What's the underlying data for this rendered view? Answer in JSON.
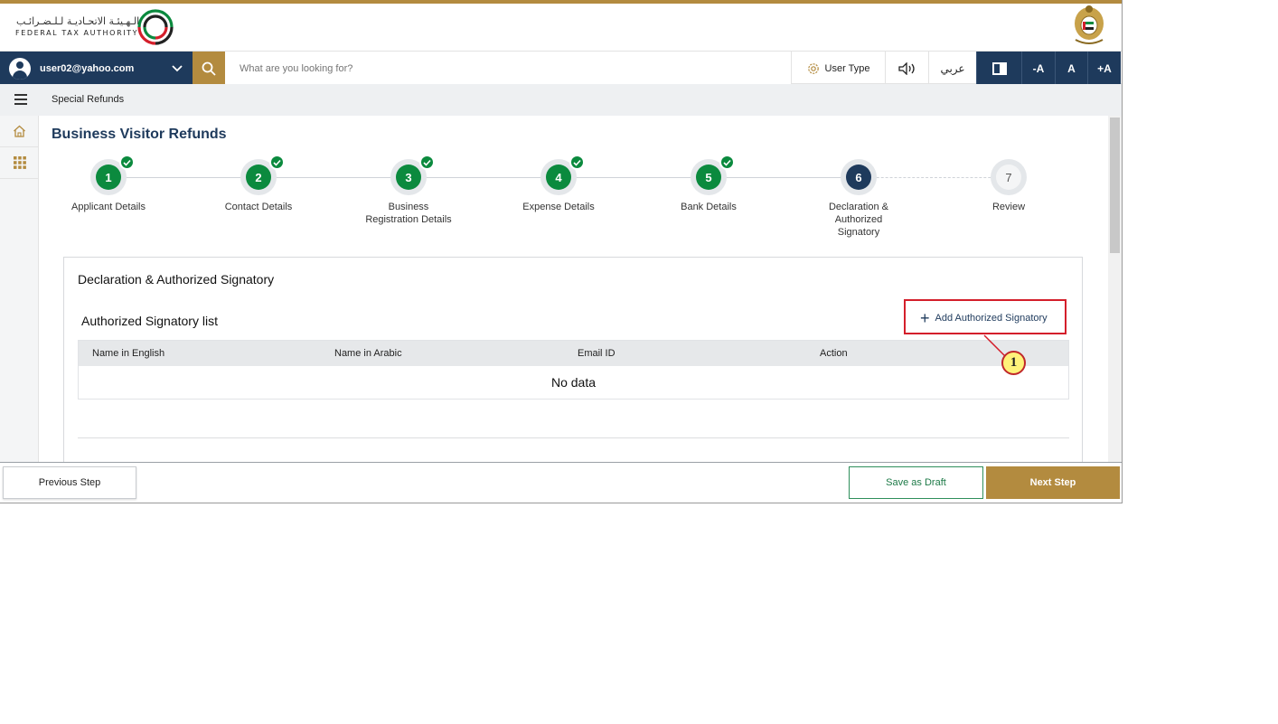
{
  "brand": {
    "name_ar": "الـهـيئـة الاتحـاديـة لـلـضـرائـب",
    "name_en": "FEDERAL TAX AUTHORITY"
  },
  "topbar": {
    "user_email": "user02@yahoo.com",
    "search_placeholder": "What are you looking for?",
    "user_type_label": "User Type",
    "language_label": "عربي",
    "font_decrease": "-A",
    "font_normal": "A",
    "font_increase": "+A"
  },
  "breadcrumb": {
    "current": "Special Refunds"
  },
  "page": {
    "title": "Business Visitor Refunds"
  },
  "stepper": {
    "steps": [
      {
        "number": "1",
        "label": "Applicant Details",
        "status": "done"
      },
      {
        "number": "2",
        "label": "Contact Details",
        "status": "done"
      },
      {
        "number": "3",
        "label": "Business Registration Details",
        "status": "done"
      },
      {
        "number": "4",
        "label": "Expense Details",
        "status": "done"
      },
      {
        "number": "5",
        "label": "Bank Details",
        "status": "done"
      },
      {
        "number": "6",
        "label": "Declaration & Authorized Signatory",
        "status": "current"
      },
      {
        "number": "7",
        "label": "Review",
        "status": "pending"
      }
    ]
  },
  "panel": {
    "title": "Declaration & Authorized Signatory",
    "list_title": "Authorized Signatory list",
    "add_button": "Add Authorized Signatory",
    "table": {
      "columns": [
        "Name in English",
        "Name in Arabic",
        "Email ID",
        "Action"
      ],
      "empty_text": "No data"
    }
  },
  "annotation": {
    "callout_number": "1"
  },
  "footer": {
    "previous": "Previous Step",
    "save_draft": "Save as Draft",
    "next": "Next Step"
  },
  "colors": {
    "primary_navy": "#1e3a5c",
    "gold": "#b38b3f",
    "success_green": "#0b8a3e",
    "annotation_red": "#d41f2b"
  }
}
